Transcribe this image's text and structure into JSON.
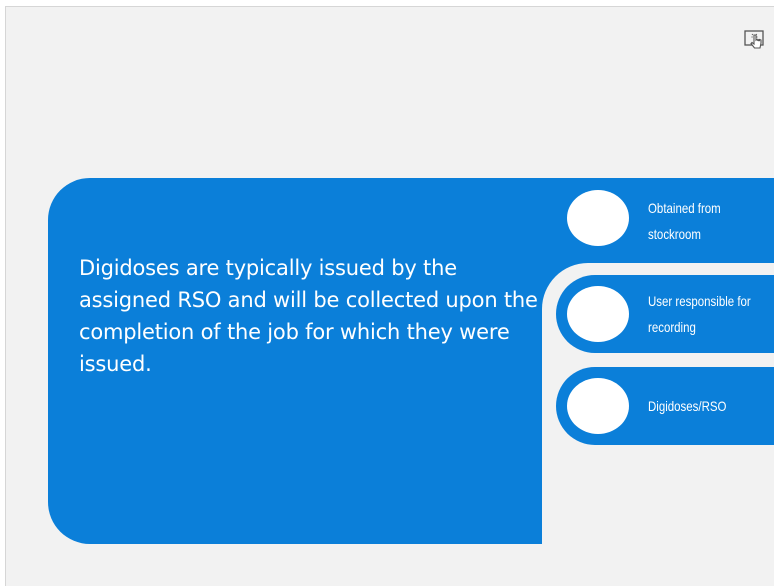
{
  "slide": {
    "body_text": "Digidoses are typically issued by the assigned RSO and will be collected upon the completion of the job for which they were issued."
  },
  "options": [
    {
      "line1": "Obtained from",
      "line2": "stockroom"
    },
    {
      "line1": "User responsible for",
      "line2": "recording"
    },
    {
      "line1": "Digidoses/RSO",
      "line2": ""
    }
  ],
  "colors": {
    "accent": "#0b7fd9",
    "background": "#f2f2f2",
    "text_on_accent": "#ffffff"
  },
  "icons": {
    "top_right": "touch-interaction-icon"
  }
}
